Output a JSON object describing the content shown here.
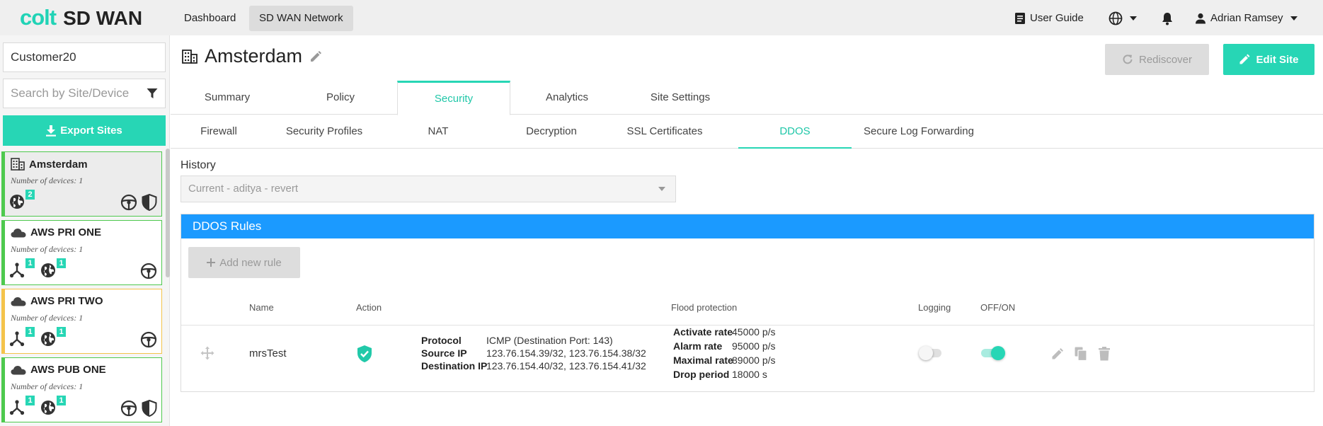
{
  "header": {
    "logo_colt": "colt",
    "logo_product": "SD WAN",
    "nav": [
      "Dashboard",
      "SD WAN Network"
    ],
    "user_guide": "User Guide",
    "user_name": "Adrian Ramsey"
  },
  "sidebar": {
    "customer_value": "Customer20",
    "search_placeholder": "Search by Site/Device",
    "export_label": "Export Sites",
    "devices_text": "Number of devices: 1",
    "sites": [
      {
        "name": "Amsterdam",
        "badges": [
          "2"
        ]
      },
      {
        "name": "AWS PRI ONE",
        "badges": [
          "1",
          "1"
        ]
      },
      {
        "name": "AWS PRI TWO",
        "badges": [
          "1",
          "1"
        ]
      },
      {
        "name": "AWS PUB ONE",
        "badges": [
          "1",
          "1"
        ]
      }
    ]
  },
  "main": {
    "title": "Amsterdam",
    "rediscover_label": "Rediscover",
    "edit_site_label": "Edit Site",
    "tabs": [
      "Summary",
      "Policy",
      "Security",
      "Analytics",
      "Site Settings"
    ],
    "active_tab": "Security",
    "subtabs": [
      "Firewall",
      "Security Profiles",
      "NAT",
      "Decryption",
      "SSL Certificates",
      "DDOS",
      "Secure Log Forwarding"
    ],
    "active_subtab": "DDOS",
    "history_label": "History",
    "history_value": "Current - aditya - revert",
    "rules_title": "DDOS Rules",
    "add_rule_label": "Add new rule",
    "columns": {
      "name": "Name",
      "action": "Action",
      "flood": "Flood protection",
      "logging": "Logging",
      "offon": "OFF/ON"
    },
    "rule": {
      "name": "mrsTest",
      "protocol_label": "Protocol",
      "protocol_value": "ICMP (Destination Port: 143)",
      "source_label": "Source IP",
      "source_value": "123.76.154.39/32, 123.76.154.38/32",
      "dest_label": "Destination IP",
      "dest_value": "123.76.154.40/32, 123.76.154.41/32",
      "activate_label": "Activate rate",
      "activate_value": "45000 p/s",
      "alarm_label": "Alarm rate",
      "alarm_value": "95000 p/s",
      "maximal_label": "Maximal rate",
      "maximal_value": "89000 p/s",
      "drop_label": "Drop period",
      "drop_value": "18000 s",
      "logging_on": false,
      "enabled": true
    }
  },
  "colors": {
    "accent": "#27d6b5",
    "header_blue": "#1b9aff",
    "status_ok": "#4ec94e",
    "status_warn": "#f4c34a"
  }
}
